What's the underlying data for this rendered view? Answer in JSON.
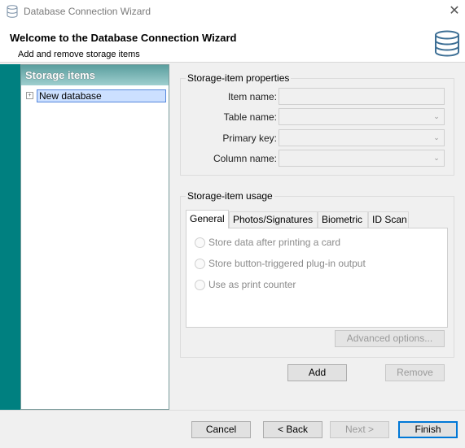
{
  "window": {
    "title": "Database Connection Wizard",
    "close_glyph": "✕"
  },
  "header": {
    "title": "Welcome to the Database Connection Wizard",
    "subtitle": "Add and remove storage items"
  },
  "tree": {
    "header": "Storage items",
    "nodes": [
      {
        "label": "New database",
        "expander": "+",
        "selected": true
      }
    ]
  },
  "properties": {
    "legend": "Storage-item properties",
    "fields": [
      {
        "label": "Item name:",
        "value": "",
        "type": "text"
      },
      {
        "label": "Table name:",
        "value": "",
        "type": "combo"
      },
      {
        "label": "Primary key:",
        "value": "",
        "type": "combo"
      },
      {
        "label": "Column name:",
        "value": "",
        "type": "combo"
      }
    ]
  },
  "usage": {
    "legend": "Storage-item usage",
    "tabs": [
      {
        "label": "General",
        "active": true
      },
      {
        "label": "Photos/Signatures",
        "active": false
      },
      {
        "label": "Biometric",
        "active": false
      },
      {
        "label": "ID Scan",
        "active": false
      }
    ],
    "options": [
      {
        "label": "Store data after printing a card",
        "checked": false
      },
      {
        "label": "Store button-triggered plug-in output",
        "checked": false
      },
      {
        "label": "Use as print counter",
        "checked": false
      }
    ],
    "advanced_label": "Advanced options..."
  },
  "actions": {
    "add_label": "Add",
    "remove_label": "Remove"
  },
  "footer": {
    "cancel_label": "Cancel",
    "back_label": "< Back",
    "next_label": "Next >",
    "finish_label": "Finish"
  },
  "colors": {
    "accent_teal": "#008080",
    "selection": "#cce0ff",
    "default_button_border": "#0078d7"
  },
  "icons": {
    "app": "database-icon",
    "header": "database-icon",
    "combo_arrow": "chevron-down-icon"
  }
}
